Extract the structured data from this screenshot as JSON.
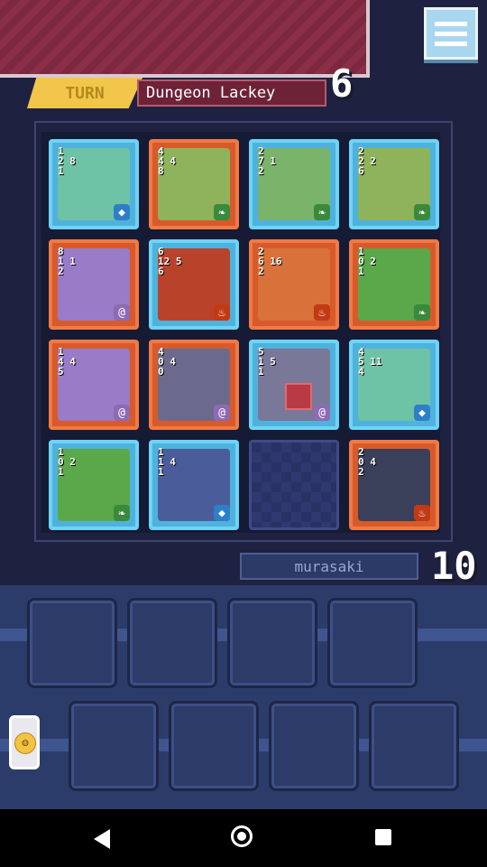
{
  "turn": {
    "label": "TURN",
    "player_name": "Dungeon Lackey",
    "opponent_score": "6"
  },
  "player": {
    "name": "murasaki",
    "score": "10"
  },
  "board": {
    "rows": [
      [
        {
          "color": "blue",
          "stats": "1\n2 8\n1",
          "element": "water",
          "art": "#6ec3a6"
        },
        {
          "color": "red",
          "stats": "4\n4 4\n8",
          "element": "leaf",
          "art": "#8fb35a"
        },
        {
          "color": "blue",
          "stats": "2\n7 1\n2",
          "element": "leaf",
          "art": "#7ab36a"
        },
        {
          "color": "blue",
          "stats": "2\n2 2\n6",
          "element": "leaf",
          "art": "#8fb35a"
        }
      ],
      [
        {
          "color": "red",
          "stats": "8\n1 1\n2",
          "element": "spiral",
          "art": "#9a7bc8"
        },
        {
          "color": "blue",
          "stats": "6\n12 5\n6",
          "element": "fire",
          "art": "#b8432a"
        },
        {
          "color": "red",
          "stats": "2\n6 16\n2",
          "element": "fire",
          "art": "#d9713a"
        },
        {
          "color": "red",
          "stats": "1\n0 2\n1",
          "element": "leaf",
          "art": "#5aa84a"
        }
      ],
      [
        {
          "color": "red",
          "stats": "1\n4 4\n5",
          "element": "spiral",
          "art": "#9a7bc8"
        },
        {
          "color": "red",
          "stats": "4\n0 4\n0",
          "element": "spiral",
          "art": "#6c6a8c"
        },
        {
          "color": "blue",
          "stats": "5\n1 5\n1",
          "element": "spiral",
          "art": "#7a7898"
        },
        {
          "color": "blue",
          "stats": "4\n5 11\n4",
          "element": "water",
          "art": "#6ec3a6"
        }
      ],
      [
        {
          "color": "blue",
          "stats": "1\n0 2\n1",
          "element": "leaf",
          "art": "#5aa84a"
        },
        {
          "color": "blue",
          "stats": "1\n1 4\n1",
          "element": "water",
          "art": "#4a5c9a"
        },
        null,
        {
          "color": "red",
          "stats": "2\n0 4\n2",
          "element": "fire",
          "art": "#3a3f5a"
        }
      ]
    ]
  },
  "colors": {
    "banner": "#8a2f46",
    "turn_tag": "#f2c64a",
    "blue_card": "#4fb2dd",
    "red_card": "#d85a2b"
  },
  "icons": {
    "menu": "menu-icon",
    "emote": "smiley-emote-icon"
  }
}
